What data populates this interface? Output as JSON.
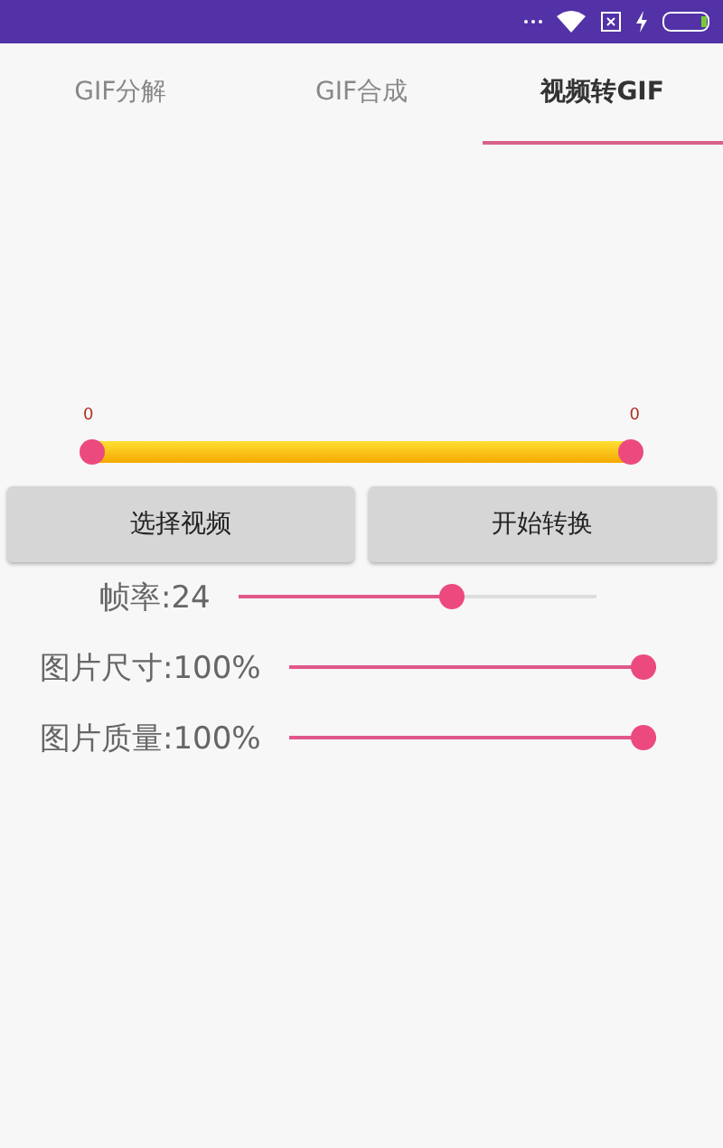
{
  "tabs": [
    {
      "label": "GIF分解",
      "selected": false
    },
    {
      "label": "GIF合成",
      "selected": false
    },
    {
      "label": "视频转GIF",
      "selected": true
    }
  ],
  "range": {
    "start": {
      "label": "0",
      "level": 0
    },
    "end": {
      "label": "0",
      "level": 1
    }
  },
  "buttons": [
    "选择视频",
    "开始转换"
  ],
  "sliders": [
    {
      "label": "帧率:24",
      "level": 0.6
    },
    {
      "label": "图片尺寸:100%",
      "level": 1
    },
    {
      "label": "图片质量:100%",
      "level": 1
    }
  ]
}
